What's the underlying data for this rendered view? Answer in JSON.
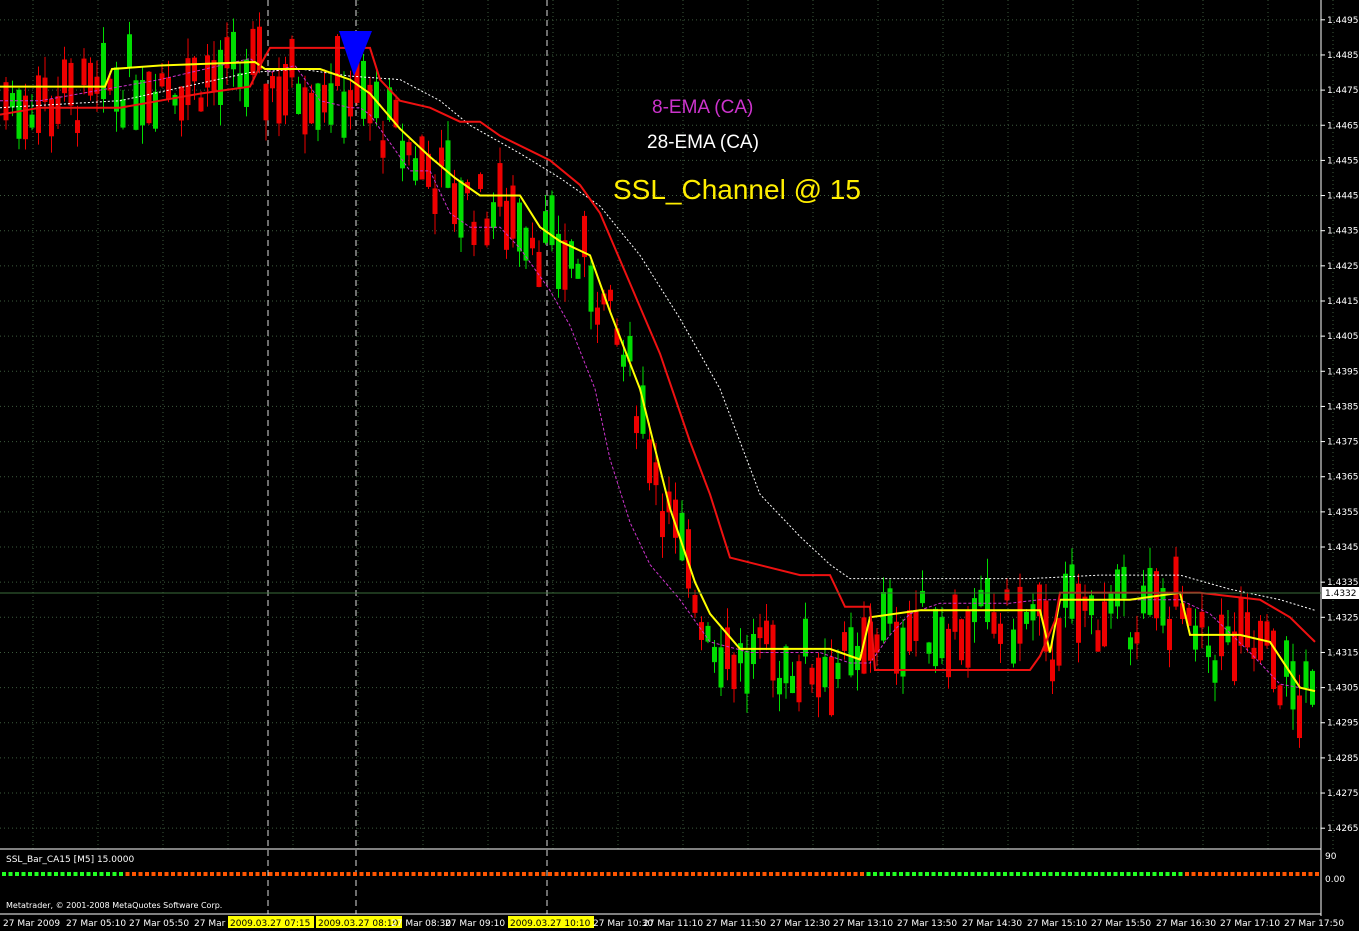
{
  "chart_data": {
    "type": "candlestick",
    "y_ticks": [
      "1.4495",
      "1.4485",
      "1.4475",
      "1.4465",
      "1.4455",
      "1.4445",
      "1.4435",
      "1.4425",
      "1.4415",
      "1.4405",
      "1.4395",
      "1.4385",
      "1.4375",
      "1.4365",
      "1.4355",
      "1.4345",
      "1.4335",
      "1.4325",
      "1.4315",
      "1.4305",
      "1.4295",
      "1.4285",
      "1.4275",
      "1.4265"
    ],
    "ylim": [
      1.42605,
      1.44995
    ],
    "current_price": "1.4332",
    "current_value": 1.4332,
    "time_labels": [
      "27 Mar 2009",
      "27 Mar 05:10",
      "27 Mar 05:50",
      "27 Mar 06:30",
      "2009.03.27 07:15",
      "2009.03.27 08:10",
      "27 Mar 08:30",
      "27 Mar 09:10",
      "2009.03.27 10:10",
      "27 Mar 10:30",
      "27 Mar 11:10",
      "27 Mar 11:50",
      "27 Mar 12:30",
      "27 Mar 13:10",
      "27 Mar 13:50",
      "27 Mar 14:30",
      "27 Mar 15:10",
      "27 Mar 15:50",
      "27 Mar 16:30",
      "27 Mar 17:10",
      "27 Mar 17:50"
    ],
    "highlighted_time_labels": [
      "2009.03.27 07:15",
      "2009.03.27 08:10",
      "2009.03.27 10:10"
    ],
    "annotations": [
      {
        "text": "8-EMA (CA)",
        "color": "#cc33cc"
      },
      {
        "text": "28-EMA (CA)",
        "color": "#ffffff"
      },
      {
        "text": "SSL_Channel @ 15",
        "color": "#ffee00"
      }
    ],
    "series": [
      {
        "role": "candles",
        "up_color": "#00dd00",
        "down_color": "#ee0000"
      },
      {
        "role": "ema8",
        "color": "#cc33cc",
        "values": [
          [
            0,
            1.4472
          ],
          [
            40,
            1.4472
          ],
          [
            160,
            1.4478
          ],
          [
            250,
            1.4484
          ],
          [
            270,
            1.448
          ],
          [
            295,
            1.4482
          ],
          [
            320,
            1.4472
          ],
          [
            350,
            1.447
          ],
          [
            360,
            1.447
          ],
          [
            370,
            1.4468
          ],
          [
            390,
            1.446
          ],
          [
            410,
            1.4452
          ],
          [
            430,
            1.4452
          ],
          [
            450,
            1.444
          ],
          [
            470,
            1.4436
          ],
          [
            500,
            1.4436
          ],
          [
            520,
            1.443
          ],
          [
            550,
            1.4418
          ],
          [
            570,
            1.4408
          ],
          [
            595,
            1.439
          ],
          [
            610,
            1.437
          ],
          [
            630,
            1.4352
          ],
          [
            650,
            1.434
          ],
          [
            680,
            1.433
          ],
          [
            710,
            1.4318
          ],
          [
            750,
            1.4315
          ],
          [
            820,
            1.4315
          ],
          [
            850,
            1.4312
          ],
          [
            870,
            1.4312
          ],
          [
            890,
            1.432
          ],
          [
            910,
            1.4326
          ],
          [
            940,
            1.4329
          ],
          [
            1010,
            1.4329
          ],
          [
            1040,
            1.433
          ],
          [
            1060,
            1.433
          ],
          [
            1100,
            1.433
          ],
          [
            1180,
            1.433
          ],
          [
            1210,
            1.4326
          ],
          [
            1250,
            1.4315
          ],
          [
            1280,
            1.4306
          ],
          [
            1300,
            1.4305
          ]
        ]
      },
      {
        "role": "ema28",
        "color": "#ffffff",
        "values": [
          [
            0,
            1.447
          ],
          [
            120,
            1.4472
          ],
          [
            250,
            1.448
          ],
          [
            300,
            1.4481
          ],
          [
            350,
            1.4479
          ],
          [
            400,
            1.4478
          ],
          [
            440,
            1.4472
          ],
          [
            470,
            1.4465
          ],
          [
            520,
            1.4457
          ],
          [
            560,
            1.445
          ],
          [
            600,
            1.4442
          ],
          [
            640,
            1.4428
          ],
          [
            680,
            1.441
          ],
          [
            720,
            1.439
          ],
          [
            760,
            1.436
          ],
          [
            800,
            1.4348
          ],
          [
            830,
            1.434
          ],
          [
            850,
            1.4336
          ],
          [
            900,
            1.4336
          ],
          [
            1030,
            1.4336
          ],
          [
            1100,
            1.4337
          ],
          [
            1180,
            1.4337
          ],
          [
            1230,
            1.4333
          ],
          [
            1280,
            1.433
          ],
          [
            1315,
            1.4327
          ]
        ]
      },
      {
        "role": "ssl_line",
        "color": "#ffff00",
        "values": [
          [
            0,
            1.4476
          ],
          [
            105,
            1.4476
          ],
          [
            112,
            1.4481
          ],
          [
            160,
            1.4482
          ],
          [
            255,
            1.4483
          ],
          [
            265,
            1.4481
          ],
          [
            280,
            1.4481
          ],
          [
            320,
            1.4481
          ],
          [
            350,
            1.4478
          ],
          [
            370,
            1.4474
          ],
          [
            400,
            1.4464
          ],
          [
            430,
            1.4456
          ],
          [
            455,
            1.445
          ],
          [
            480,
            1.4445
          ],
          [
            520,
            1.4445
          ],
          [
            540,
            1.4436
          ],
          [
            560,
            1.4432
          ],
          [
            590,
            1.4428
          ],
          [
            610,
            1.4412
          ],
          [
            640,
            1.439
          ],
          [
            670,
            1.4356
          ],
          [
            695,
            1.4335
          ],
          [
            710,
            1.4326
          ],
          [
            740,
            1.4316
          ],
          [
            830,
            1.4316
          ],
          [
            860,
            1.4313
          ],
          [
            870,
            1.4325
          ],
          [
            920,
            1.4327
          ],
          [
            1040,
            1.4327
          ],
          [
            1050,
            1.4315
          ],
          [
            1060,
            1.433
          ],
          [
            1130,
            1.433
          ],
          [
            1180,
            1.4332
          ],
          [
            1190,
            1.432
          ],
          [
            1240,
            1.432
          ],
          [
            1270,
            1.4318
          ],
          [
            1300,
            1.4305
          ],
          [
            1315,
            1.4304
          ]
        ]
      },
      {
        "role": "ssl_channel",
        "color": "#ee1111",
        "values": [
          [
            0,
            1.4468
          ],
          [
            40,
            1.447
          ],
          [
            120,
            1.447
          ],
          [
            160,
            1.4472
          ],
          [
            200,
            1.4474
          ],
          [
            250,
            1.4476
          ],
          [
            262,
            1.4483
          ],
          [
            270,
            1.4487
          ],
          [
            370,
            1.4487
          ],
          [
            380,
            1.4478
          ],
          [
            400,
            1.4472
          ],
          [
            430,
            1.447
          ],
          [
            460,
            1.4466
          ],
          [
            480,
            1.4466
          ],
          [
            500,
            1.4462
          ],
          [
            550,
            1.4455
          ],
          [
            580,
            1.4448
          ],
          [
            600,
            1.444
          ],
          [
            630,
            1.442
          ],
          [
            660,
            1.44
          ],
          [
            690,
            1.4375
          ],
          [
            710,
            1.436
          ],
          [
            730,
            1.4342
          ],
          [
            800,
            1.4337
          ],
          [
            830,
            1.4337
          ],
          [
            845,
            1.4328
          ],
          [
            870,
            1.4328
          ],
          [
            875,
            1.431
          ],
          [
            930,
            1.431
          ],
          [
            1030,
            1.431
          ],
          [
            1040,
            1.4314
          ],
          [
            1055,
            1.4324
          ],
          [
            1060,
            1.4332
          ],
          [
            1180,
            1.4332
          ],
          [
            1200,
            1.4332
          ],
          [
            1260,
            1.433
          ],
          [
            1290,
            1.4325
          ],
          [
            1315,
            1.4318
          ]
        ]
      }
    ]
  },
  "indicator": {
    "label": "SSL_Bar_CA15 [M5] 15.0000",
    "scale_top": "90",
    "scale_zero": "0.00"
  },
  "copyright": "Metatrader, © 2001-2008 MetaQuotes Software Corp."
}
